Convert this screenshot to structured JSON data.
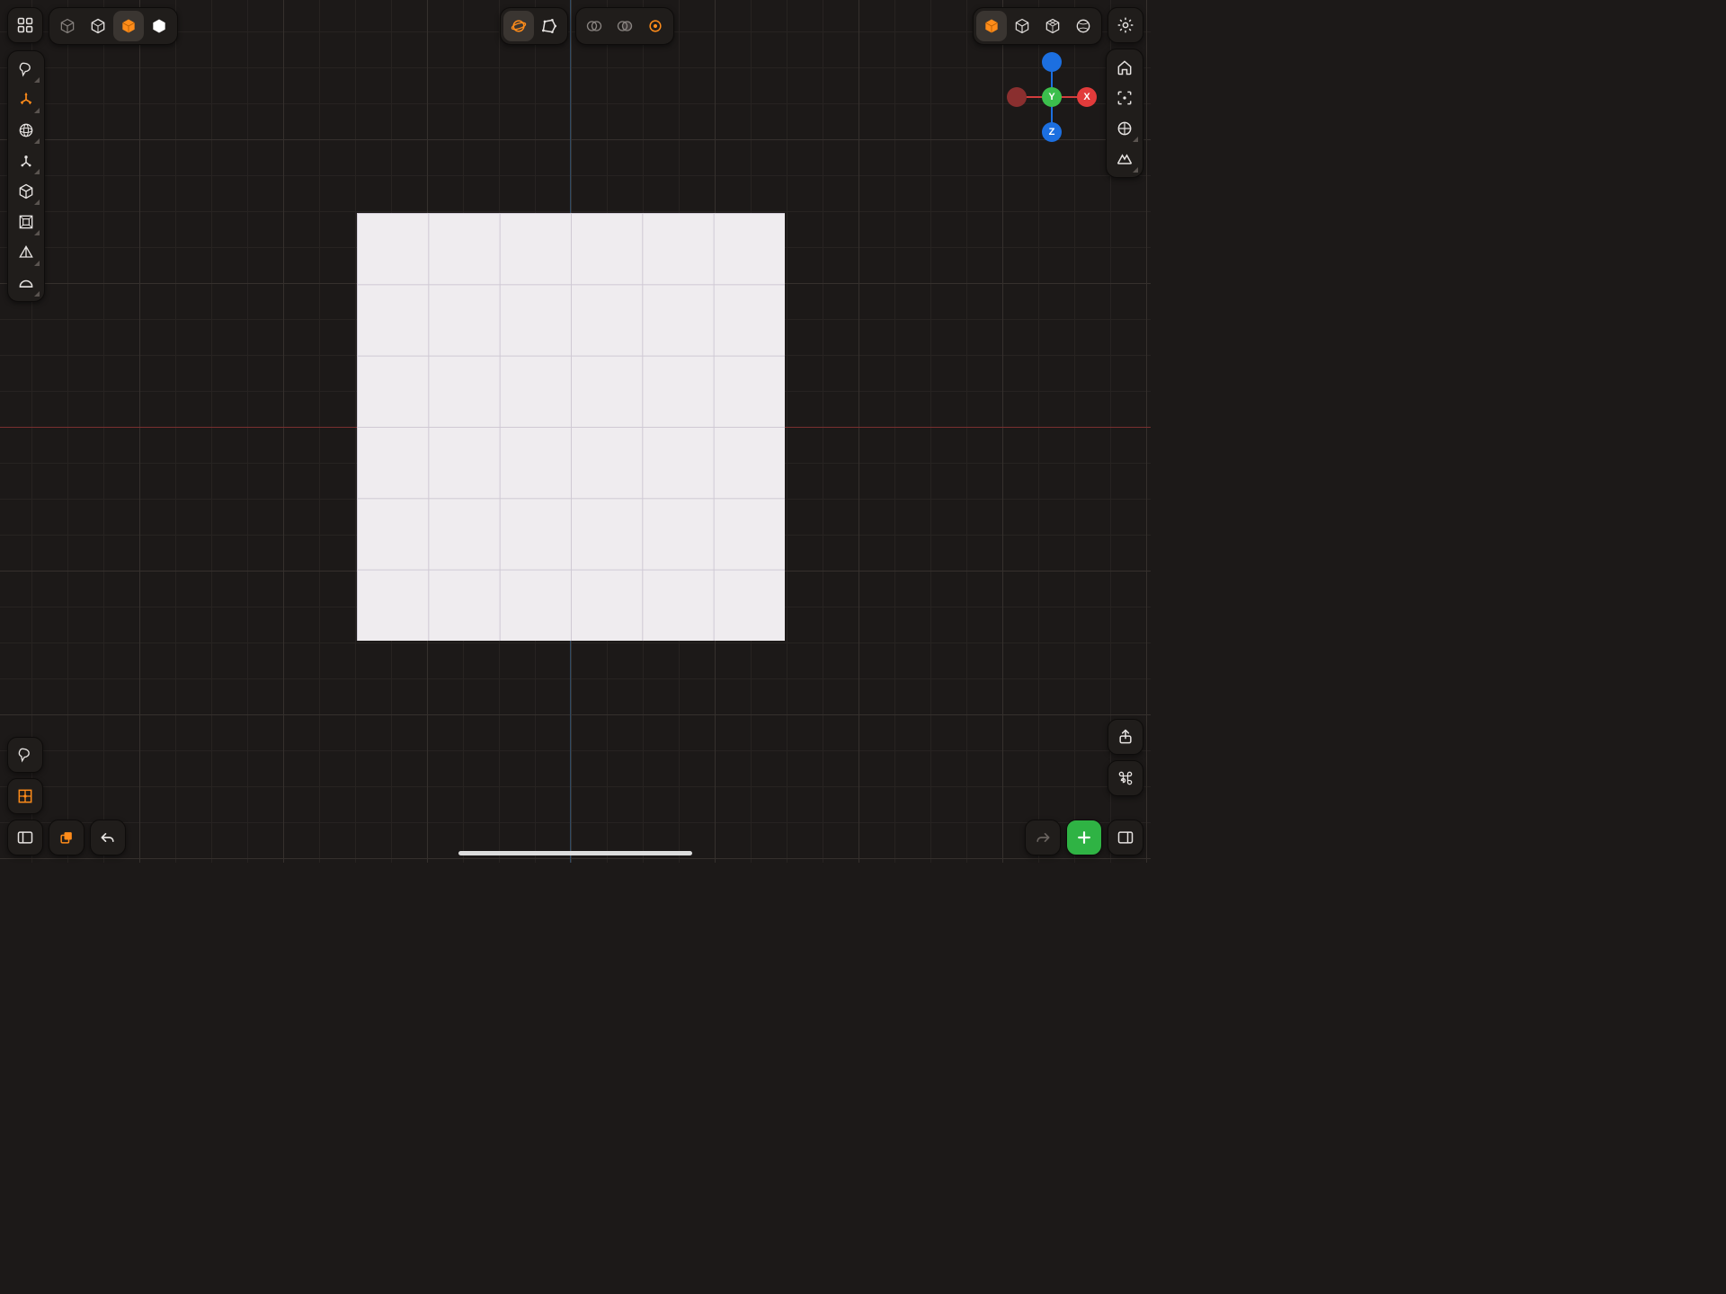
{
  "gizmo": {
    "x_label": "X",
    "y_label": "Y",
    "z_label": "Z"
  },
  "top_left": {
    "apps_icon": "apps-grid",
    "modes": [
      "wireframe-cube",
      "outline-cube",
      "solid-cube",
      "white-hexagon"
    ],
    "active_index": 2
  },
  "top_center": {
    "orbit": "orbit-sphere",
    "polygon": "polygon-shape",
    "boolean_a": "boolean-union",
    "boolean_b": "boolean-subtract",
    "boolean_c": "boolean-intersect"
  },
  "top_right": {
    "shading": [
      "solid-shaded",
      "wireframe",
      "dev-wireframe",
      "matcap-sphere"
    ],
    "active_index": 0,
    "settings": "settings-gear"
  },
  "right_rail": {
    "home": "home",
    "focus": "focus-target",
    "perspective": "perspective-grid",
    "symmetry": "symmetry-mirror"
  },
  "left_tools": [
    {
      "name": "select-lasso",
      "accent": false
    },
    {
      "name": "move-gizmo",
      "accent": true
    },
    {
      "name": "rotate-sphere",
      "accent": false
    },
    {
      "name": "pivot",
      "accent": false
    },
    {
      "name": "primitive-cube",
      "accent": false
    },
    {
      "name": "frame",
      "accent": false
    },
    {
      "name": "primitive-pyramid",
      "accent": false
    },
    {
      "name": "primitive-hemisphere",
      "accent": false
    }
  ],
  "bottom_left": {
    "touch": "touch-hand",
    "snap": "snap-grid",
    "panel": "panel-left",
    "layers": "layers-stack",
    "undo": "undo"
  },
  "bottom_right": {
    "share": "share",
    "shortcuts": "command-key",
    "redo": "redo",
    "add": "add-plus",
    "panel": "panel-right"
  }
}
